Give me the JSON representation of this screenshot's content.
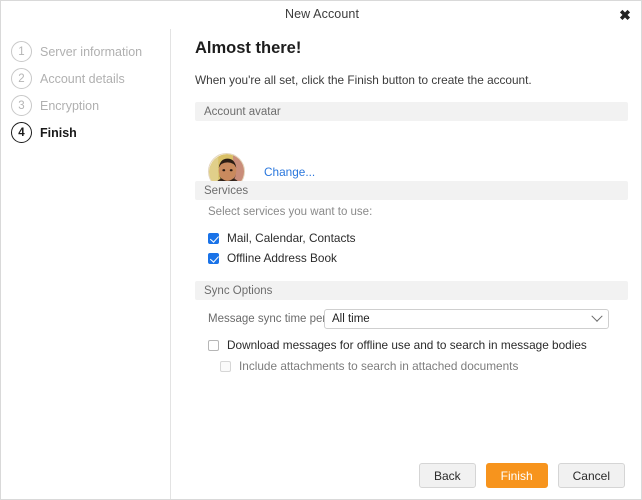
{
  "window": {
    "title": "New Account",
    "close_label": "✖"
  },
  "sidebar": {
    "steps": [
      {
        "num": "1",
        "label": "Server information",
        "active": false
      },
      {
        "num": "2",
        "label": "Account details",
        "active": false
      },
      {
        "num": "3",
        "label": "Encryption",
        "active": false
      },
      {
        "num": "4",
        "label": "Finish",
        "active": true
      }
    ]
  },
  "main": {
    "title": "Almost there!",
    "subtitle": "When you're all set, click the Finish button to create the account.",
    "avatar_section": {
      "header": "Account avatar",
      "change_label": "Change...",
      "avatar_alt": "user-avatar-photo"
    },
    "services_section": {
      "header": "Services",
      "hint": "Select services you want to use:",
      "items": [
        {
          "label": "Mail, Calendar, Contacts",
          "checked": true,
          "disabled": false
        },
        {
          "label": "Offline Address Book",
          "checked": true,
          "disabled": false
        }
      ]
    },
    "sync_section": {
      "header": "Sync Options",
      "select_label": "Message sync time period:",
      "select_value": "All time",
      "select_options": [
        "All time"
      ],
      "items": [
        {
          "label": "Download messages for offline use and to search in message bodies",
          "checked": false,
          "disabled": false
        },
        {
          "label": "Include attachments to search in attached documents",
          "checked": false,
          "disabled": true
        }
      ]
    }
  },
  "footer": {
    "back_label": "Back",
    "finish_label": "Finish",
    "cancel_label": "Cancel"
  },
  "colors": {
    "accent_orange": "#f7941d",
    "link_blue": "#2a77dd",
    "checkbox_blue": "#1a73e8",
    "section_header_bg": "#f2f2f2"
  }
}
